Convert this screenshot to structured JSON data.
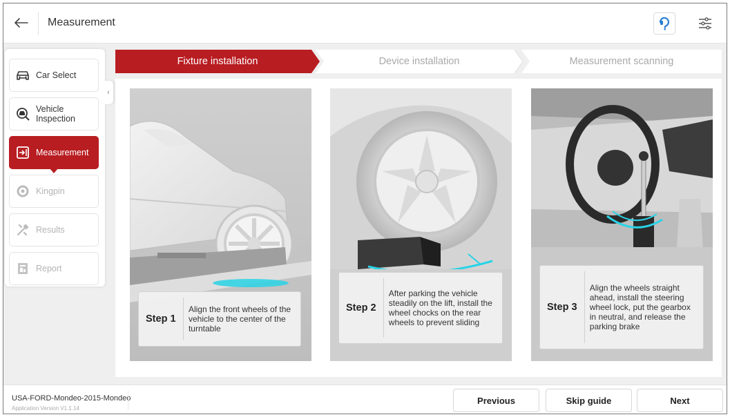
{
  "header": {
    "title": "Measurement",
    "back_icon": "arrow-left-icon",
    "help_icon": "help-icon",
    "settings_icon": "settings-sliders-icon",
    "help_color": "#2a7fd4"
  },
  "sidebar": {
    "items": [
      {
        "label": "Car Select",
        "icon": "car-icon",
        "state": "normal"
      },
      {
        "label": "Vehicle\nInspection",
        "icon": "inspection-icon",
        "state": "normal"
      },
      {
        "label": "Measurement",
        "icon": "measurement-icon",
        "state": "active"
      },
      {
        "label": "Kingpin",
        "icon": "kingpin-icon",
        "state": "disabled"
      },
      {
        "label": "Results",
        "icon": "results-icon",
        "state": "disabled"
      },
      {
        "label": "Report",
        "icon": "report-icon",
        "state": "disabled"
      }
    ],
    "collapse_glyph": "‹"
  },
  "steps": [
    {
      "label": "Fixture installation",
      "active": true
    },
    {
      "label": "Device installation",
      "active": false
    },
    {
      "label": "Measurement scanning",
      "active": false
    }
  ],
  "cards": [
    {
      "step": "Step 1",
      "text": "Align the front wheels of the vehicle to the center of the turntable"
    },
    {
      "step": "Step 2",
      "text": "After parking the vehicle steadily on the lift, install the wheel chocks on the rear wheels to prevent sliding"
    },
    {
      "step": "Step 3",
      "text": "Align the wheels straight ahead, install the steering wheel lock, put the gearbox in neutral, and release the parking brake"
    }
  ],
  "footer": {
    "vehicle": "USA-FORD-Mondeo-2015-Mondeo",
    "version": "Application Version V1.1.14",
    "previous": "Previous",
    "skip": "Skip guide",
    "next": "Next"
  },
  "colors": {
    "accent": "#b81d22",
    "highlight": "#29d3e6"
  }
}
